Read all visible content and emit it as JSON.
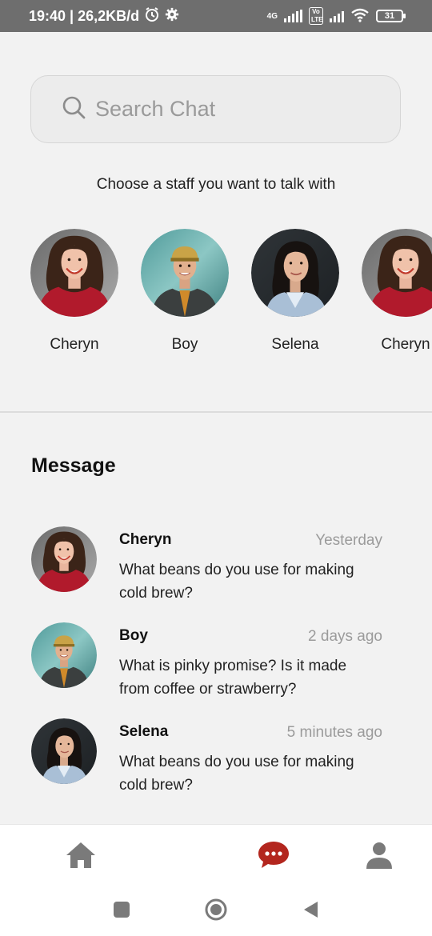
{
  "status_bar": {
    "time_net": "19:40 | 26,2KB/d",
    "network_label": "4G",
    "volte_label": "Vo LTE",
    "battery": "31"
  },
  "search": {
    "placeholder": "Search Chat"
  },
  "choose_text": "Choose a staff you want to talk with",
  "staff": [
    {
      "name": "Cheryn"
    },
    {
      "name": "Boy"
    },
    {
      "name": "Selena"
    },
    {
      "name": "Cheryn"
    }
  ],
  "messages_title": "Message",
  "messages": [
    {
      "name": "Cheryn",
      "time": "Yesterday",
      "text": "What beans do you use for making cold brew?"
    },
    {
      "name": "Boy",
      "time": "2 days ago",
      "text": "What is pinky promise? Is it made from coffee or strawberry?"
    },
    {
      "name": "Selena",
      "time": "5 minutes ago",
      "text": "What beans do you use for making cold brew?"
    }
  ],
  "nav": {
    "active": "chat",
    "icons": [
      "home-icon",
      "chat-icon",
      "profile-icon"
    ],
    "accent_color": "#b3261e",
    "inactive_color": "#7a7a7a"
  },
  "system_nav": {
    "icons": [
      "recents-icon",
      "home-circle-icon",
      "back-icon"
    ]
  }
}
